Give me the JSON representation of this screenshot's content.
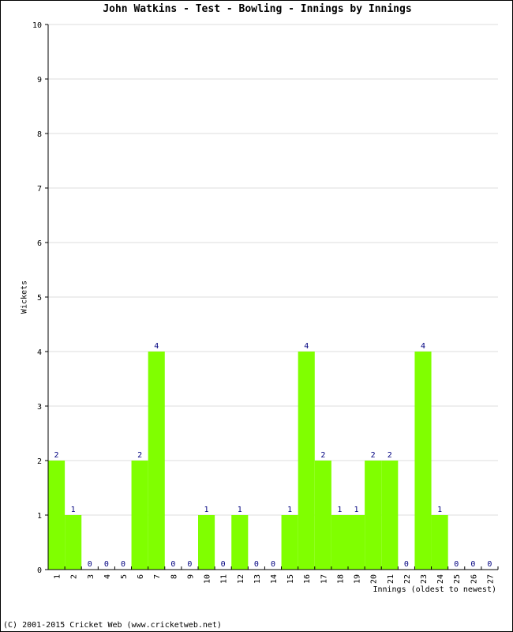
{
  "chart_data": {
    "type": "bar",
    "title": "John Watkins - Test - Bowling - Innings by Innings",
    "xlabel": "Innings (oldest to newest)",
    "ylabel": "Wickets",
    "ylim": [
      0,
      10
    ],
    "yticks": [
      0,
      1,
      2,
      3,
      4,
      5,
      6,
      7,
      8,
      9,
      10
    ],
    "grid": true,
    "categories": [
      "1",
      "2",
      "3",
      "4",
      "5",
      "6",
      "7",
      "8",
      "9",
      "10",
      "11",
      "12",
      "13",
      "14",
      "15",
      "16",
      "17",
      "18",
      "19",
      "20",
      "21",
      "22",
      "23",
      "24",
      "25",
      "26",
      "27"
    ],
    "values": [
      2,
      1,
      0,
      0,
      0,
      2,
      4,
      0,
      0,
      1,
      0,
      1,
      0,
      0,
      1,
      4,
      2,
      1,
      1,
      2,
      2,
      0,
      4,
      1,
      0,
      0,
      0
    ],
    "bar_color": "#80ff00",
    "label_color": "#000080"
  },
  "footer": "(C) 2001-2015 Cricket Web (www.cricketweb.net)"
}
